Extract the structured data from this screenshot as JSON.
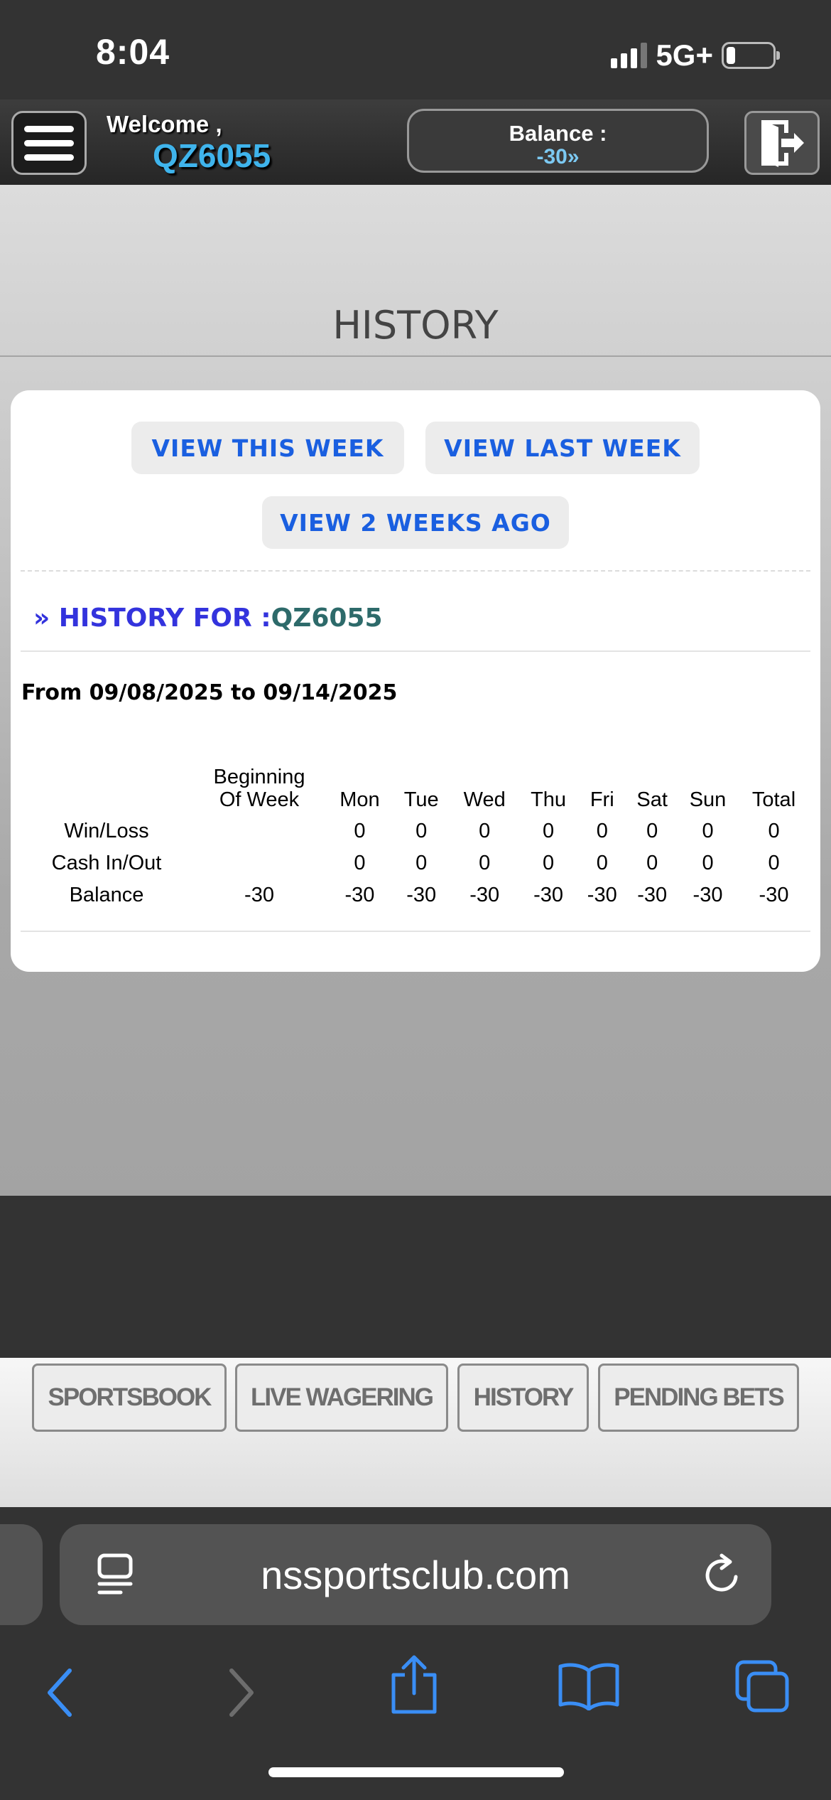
{
  "status_bar": {
    "time": "8:04",
    "network": "5G+"
  },
  "header": {
    "welcome_label": "Welcome ,",
    "username": "QZ6055",
    "balance_label": "Balance :",
    "balance_value": "-30»"
  },
  "page": {
    "title": "HISTORY",
    "buttons": {
      "this_week": "VIEW THIS WEEK",
      "last_week": "VIEW LAST WEEK",
      "two_weeks_ago": "VIEW 2 WEEKS AGO"
    },
    "history_for_label": "» HISTORY FOR :",
    "history_for_user": "QZ6055",
    "date_range": "From 09/08/2025 to 09/14/2025"
  },
  "table": {
    "headers": {
      "beginning_line1": "Beginning",
      "beginning_line2": "Of Week",
      "mon": "Mon",
      "tue": "Tue",
      "wed": "Wed",
      "thu": "Thu",
      "fri": "Fri",
      "sat": "Sat",
      "sun": "Sun",
      "total": "Total"
    },
    "rows": [
      {
        "label": "Win/Loss",
        "bow": "",
        "mon": "0",
        "tue": "0",
        "wed": "0",
        "thu": "0",
        "fri": "0",
        "sat": "0",
        "sun": "0",
        "total": "0"
      },
      {
        "label": "Cash In/Out",
        "bow": "",
        "mon": "0",
        "tue": "0",
        "wed": "0",
        "thu": "0",
        "fri": "0",
        "sat": "0",
        "sun": "0",
        "total": "0"
      },
      {
        "label": "Balance",
        "bow": "-30",
        "mon": "-30",
        "tue": "-30",
        "wed": "-30",
        "thu": "-30",
        "fri": "-30",
        "sat": "-30",
        "sun": "-30",
        "total": "-30"
      }
    ]
  },
  "bottom_nav": {
    "sportsbook": "SPORTSBOOK",
    "live_wagering": "LIVE WAGERING",
    "history": "HISTORY",
    "pending_bets": "PENDING BETS"
  },
  "browser": {
    "url": "nssportsclub.com"
  },
  "colors": {
    "accent_blue": "#1a5fe0",
    "username_blue": "#3fb4ec",
    "history_for_blue": "#3333dd",
    "history_for_user_teal": "#2d6a6a",
    "safari_blue": "#3a8ef5"
  },
  "icons": {
    "menu": "hamburger-menu-icon",
    "logout": "logout-door-icon",
    "signal": "cellular-signal-icon",
    "battery": "battery-icon",
    "page_settings": "page-menu-icon",
    "reload": "reload-icon",
    "back": "back-chevron-icon",
    "forward": "forward-chevron-icon",
    "share": "share-icon",
    "bookmarks": "bookmarks-book-icon",
    "tabs": "tabs-icon"
  }
}
